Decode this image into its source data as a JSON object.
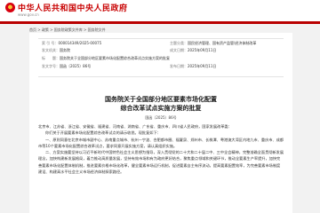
{
  "header": {
    "site_title": "中华人民共和国中央人民政府",
    "site_url": "www.gov.cn"
  },
  "breadcrumb": "首页 > 政策 > 国务院政策文件库 > 国务院文件",
  "meta": {
    "index_label": "索 引 号：",
    "index_value": "000014349/2025-00075",
    "topic_label": "主题分类：",
    "topic_value": "国民经济管理、国有资产监管\\经济体制改革",
    "issuer_label": "发文机关：",
    "issuer_value": "国务院",
    "created_label": "成文日期：",
    "created_value": "2025年09月11日",
    "title_label": "标　　题：",
    "title_value": "国务院关于全国部分地区要素市场化配置综合改革试点实施方案的批复",
    "docno_label": "发文字号：",
    "docno_value": "国函〔2025〕86号",
    "published_label": "发布日期：",
    "published_value": "2025年09月11日"
  },
  "document": {
    "title_line1": "国务院关于全国部分地区要素市场化配置",
    "title_line2": "综合改革试点实施方案的批复",
    "doc_number": "国函〔2025〕86号",
    "paragraphs": [
      "北京市、江苏省、浙江省、安徽省、福建省、河南省、湖南省、广东省、重庆市、四川省人民政府，国家发展改革委：",
      "你们关于开展要素市场化配置综合改革试点的请示收悉。现批复如下：",
      "一、原则同意在北京市城市副中心、苏南重点城市、杭州—宁波、合肥都市圈、福厦泉、郑州市、长株潭、粤港澳大湾区内地九市、重庆市、成都市等10个要素市场化配置综合改革试点，要求同意开展实施方案，请认真组织实施。",
      "二、方案实施要坚持以习近平新时代中国特色社会主义思想为指导，深入贯彻党的二十大和二十届二中、三中全会精神，完整准确全面贯彻新发展理念，加快构建新发展格局，着力推动高质量发展，坚持有效市场和有为政府更好结合，聚焦重点领域和关键环节，推动全要素生产率提升，加快完善要素市场化配置体制机制，推进要素价格市场化改革，健全要素市场运行机制，促进要素自主有序流动，提高要素配置效率，为完善要素市场制度建设、构建高水平社会主义市场经济体制探索路径。"
    ]
  }
}
